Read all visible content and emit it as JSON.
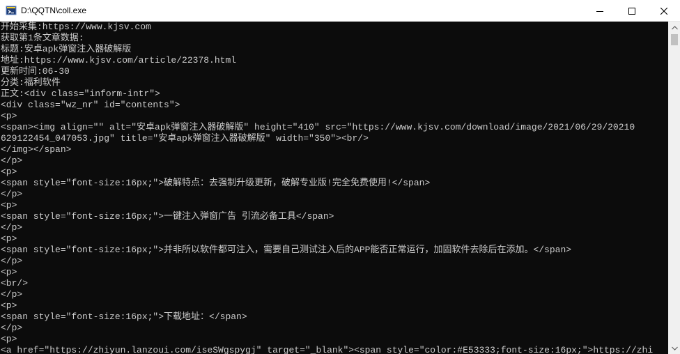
{
  "window": {
    "title": "D:\\QQTN\\coll.exe",
    "icon": "console-app-icon",
    "controls": [
      "minimize-icon",
      "maximize-icon",
      "close-icon"
    ]
  },
  "console": {
    "lines": [
      "开始采集:https://www.kjsv.com",
      "获取第1条文章数据:",
      "标题:安卓apk弹窗注入器破解版",
      "地址:https://www.kjsv.com/article/22378.html",
      "更新时间:06-30",
      "分类:福利软件",
      "正文:<div class=\"inform-intr\">",
      "<div class=\"wz_nr\" id=\"contents\">",
      "<p>",
      "<span><img align=\"\" alt=\"安卓apk弹窗注入器破解版\" height=\"410\" src=\"https://www.kjsv.com/download/image/2021/06/29/20210",
      "629122454_047053.jpg\" title=\"安卓apk弹窗注入器破解版\" width=\"350\"><br/>",
      "</img></span>",
      "</p>",
      "<p>",
      "<span style=\"font-size:16px;\">破解特点：去强制升级更新，破解专业版!完全免费使用!</span>",
      "</p>",
      "<p>",
      "<span style=\"font-size:16px;\">一键注入弹窗广告 引流必备工具</span>",
      "</p>",
      "<p>",
      "<span style=\"font-size:16px;\">并非所以软件都可注入，需要自己测试注入后的APP能否正常运行，加固软件去除后在添加。</span>",
      "</p>",
      "<p>",
      "<br/>",
      "</p>",
      "<p>",
      "<span style=\"font-size:16px;\">下载地址：</span>",
      "</p>",
      "<p>",
      "<a href=\"https://zhiyun.lanzoui.com/iseSWgspygj\" target=\"_blank\"><span style=\"color:#E53333;font-size:16px;\">https://zhi"
    ]
  },
  "colors": {
    "console_bg": "#0c0c0c",
    "console_text": "#cccccc",
    "titlebar_bg": "#ffffff",
    "scrollbar_bg": "#f0f0f0",
    "scrollbar_thumb": "#c1c1c1"
  }
}
